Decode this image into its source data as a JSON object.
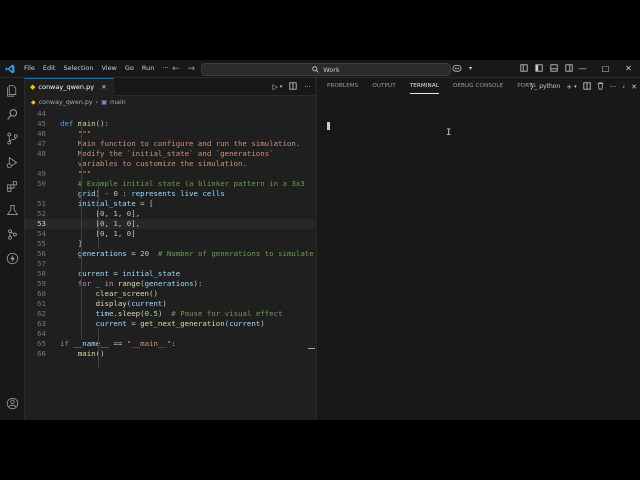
{
  "titlebar": {
    "menu": [
      "File",
      "Edit",
      "Selection",
      "View",
      "Go",
      "Run",
      "···"
    ],
    "command_center": "Work",
    "window_controls": [
      "—",
      "□",
      "✕"
    ]
  },
  "editor": {
    "tab_label": "conway_qwen.py",
    "breadcrumb_file": "conway_qwen.py",
    "breadcrumb_symbol": "main",
    "active_line": "53",
    "lines": [
      {
        "n": "44",
        "t": ""
      },
      {
        "n": "45",
        "t": "def main():"
      },
      {
        "n": "46",
        "t": "    \"\"\""
      },
      {
        "n": "47",
        "t": "    Main function to configure and run the simulation."
      },
      {
        "n": "48",
        "t": "    Modify the `initial_state` and `generations`"
      },
      {
        "n": "",
        "t": "    variables to customize the simulation."
      },
      {
        "n": "49",
        "t": "    \"\"\""
      },
      {
        "n": "50",
        "t": "    # Example initial state (a blinker pattern in a 3x3"
      },
      {
        "n": "",
        "t": "    grid) - 0 : represents live cells"
      },
      {
        "n": "51",
        "t": "    initial_state = ["
      },
      {
        "n": "52",
        "t": "        [0, 1, 0],"
      },
      {
        "n": "53",
        "t": "        [0, 1, 0],"
      },
      {
        "n": "54",
        "t": "        [0, 1, 0]"
      },
      {
        "n": "55",
        "t": "    ]"
      },
      {
        "n": "56",
        "t": "    generations = 20  # Number of generations to simulate"
      },
      {
        "n": "57",
        "t": ""
      },
      {
        "n": "58",
        "t": "    current = initial_state"
      },
      {
        "n": "59",
        "t": "    for _ in range(generations):"
      },
      {
        "n": "60",
        "t": "        clear_screen()"
      },
      {
        "n": "61",
        "t": "        display(current)"
      },
      {
        "n": "62",
        "t": "        time.sleep(0.5)  # Pause for visual effect"
      },
      {
        "n": "63",
        "t": "        current = get_next_generation(current)"
      },
      {
        "n": "64",
        "t": ""
      },
      {
        "n": "65",
        "t": "if __name__ == \"__main__\":"
      },
      {
        "n": "66",
        "t": "    main()"
      }
    ]
  },
  "panel": {
    "tabs": [
      "PROBLEMS",
      "OUTPUT",
      "TERMINAL",
      "DEBUG CONSOLE",
      "PORTS"
    ],
    "active_tab": "TERMINAL",
    "terminal_profile": "python"
  },
  "colors": {
    "accent": "#0078d4",
    "background": "#1f1f1f",
    "sidebar": "#181818"
  }
}
